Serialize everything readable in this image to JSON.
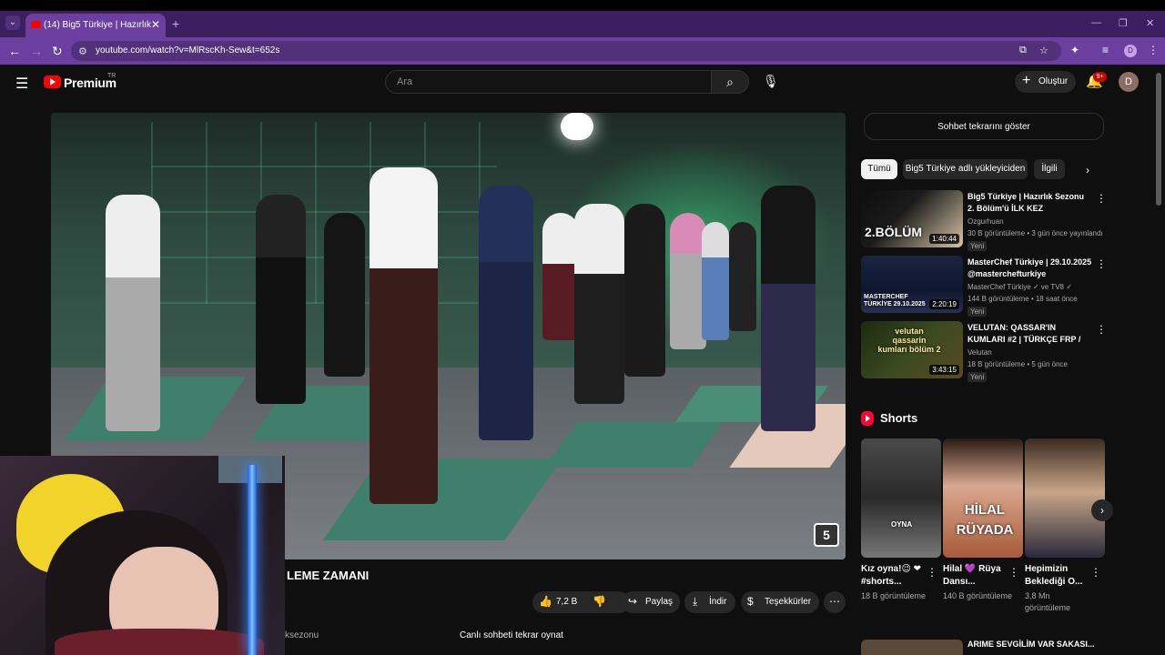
{
  "browser": {
    "tab_title": "(14) Big5 Türkiye | Hazırlık Sezonu",
    "url": "youtube.com/watch?v=MlRscKh-Sew&t=652s",
    "profile_initial": "D"
  },
  "header": {
    "logo_text": "Premium",
    "logo_country": "TR",
    "search_placeholder": "Ara",
    "create_label": "Oluştur",
    "notif_count": "9+",
    "avatar_initial": "D"
  },
  "video": {
    "title_fragment": "LEME ZAMANI",
    "hashtag_fragment": "ksezonu",
    "channel_logo": "5"
  },
  "actions": {
    "like_count": "7,2 B",
    "share_label": "Paylaş",
    "download_label": "İndir",
    "thanks_label": "Teşekkürler",
    "chat_replay_label": "Canlı sohbeti tekrar oynat"
  },
  "sidebar": {
    "chat_toggle": "Sohbet tekrarını göster",
    "chips": [
      "Tümü",
      "Big5 Türkiye adlı yükleyiciden",
      "İlgili"
    ],
    "recs": [
      {
        "title": "Big5 Türkiye | Hazırlık Sezonu 2. Bölüm'ü İLK KEZ İZLİYORUM! ...",
        "channel": "Ozgurhuan",
        "meta": "30 B görüntüleme • 3 gün önce yayınlandı",
        "badge": "Yeni",
        "duration": "1:40:44",
        "thumb_text": "2.BÖLÜM"
      },
      {
        "title": "MasterChef Türkiye | 29.10.2025 @masterchefturkiye",
        "channel": "MasterChef Türkiye ✓ ve TV8 ✓",
        "meta": "144 B görüntüleme • 18 saat önce",
        "badge": "Yeni",
        "duration": "2:20:19",
        "thumb_text": "MASTERCHEF TÜRKİYE 29.10.2025"
      },
      {
        "title": "VELUTAN: QASSAR'IN KUMLARI #2 | TÜRKÇE FRP / RPG ...",
        "channel": "Velutan",
        "meta": "18 B görüntüleme • 5 gün önce",
        "badge": "Yeni",
        "duration": "3:43:15",
        "thumb_text": "velutan qassarin kumları bölüm 2"
      }
    ],
    "shorts_title": "Shorts",
    "shorts": [
      {
        "title": "Kız oyna!😉 ❤ #shorts...",
        "views": "18 B görüntüleme",
        "overlay": "OYNA"
      },
      {
        "title": "Hilal 💜 Rüya Dansı...",
        "views": "140 B görüntüleme",
        "overlay": "HİLAL RÜYADA"
      },
      {
        "title": "Hepimizin Beklediği O...",
        "views": "3,8 Mn görüntüleme",
        "overlay": ""
      }
    ],
    "next_row_title": "ARIME SEVGİLİM VAR SAKASI..."
  }
}
